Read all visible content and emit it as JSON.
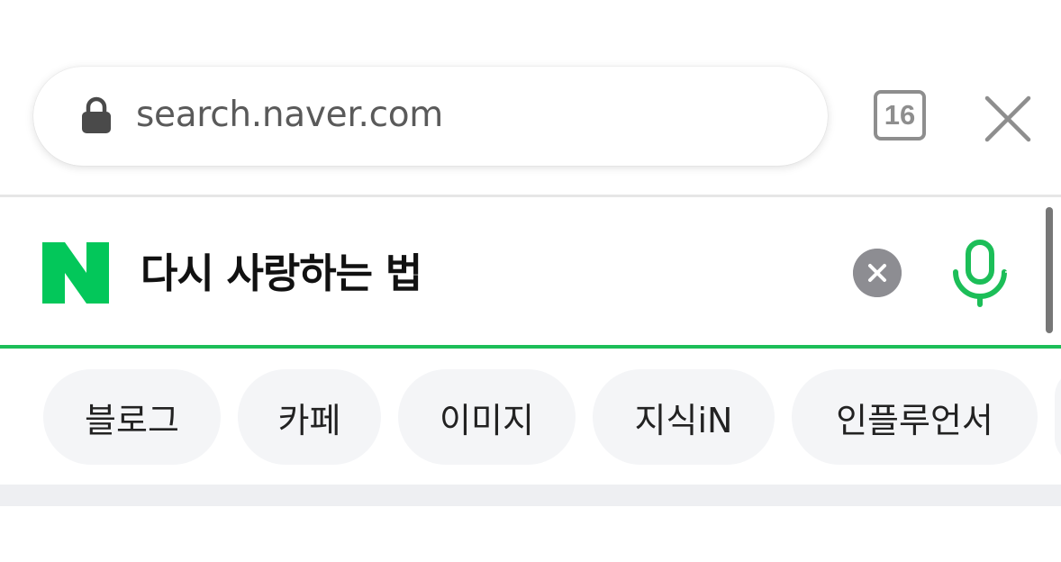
{
  "browser": {
    "url": "search.naver.com",
    "tab_count": "16",
    "icons": {
      "lock": "lock-icon",
      "close": "close-icon"
    }
  },
  "search": {
    "query": "다시 사랑하는 법",
    "brand_color": "#03C75A",
    "accent_line_color": "#1CBE58",
    "icons": {
      "logo": "naver-n-logo",
      "clear": "clear-circle-x-icon",
      "voice": "microphone-icon"
    }
  },
  "categories": [
    {
      "label": "블로그"
    },
    {
      "label": "카페"
    },
    {
      "label": "이미지"
    },
    {
      "label": "지식iN"
    },
    {
      "label": "인플루언서"
    }
  ]
}
